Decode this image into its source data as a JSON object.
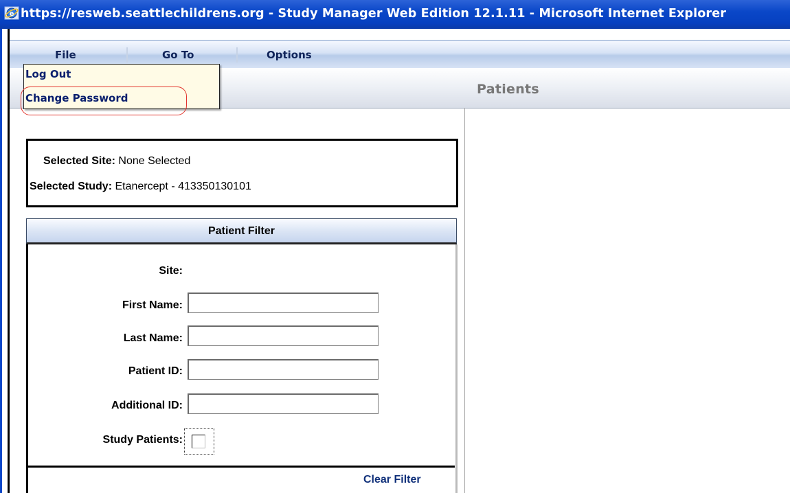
{
  "window": {
    "title": "https://resweb.seattlechildrens.org - Study Manager Web Edition 12.1.11 - Microsoft Internet Explorer"
  },
  "menubar": {
    "items": [
      {
        "label": "File"
      },
      {
        "label": "Go To"
      },
      {
        "label": "Options"
      }
    ]
  },
  "file_menu": {
    "items": [
      {
        "label": "Log Out"
      },
      {
        "label": "Change Password"
      }
    ],
    "highlight_color": "#e2362e"
  },
  "header": {
    "title": "Patients"
  },
  "selection": {
    "site_label": "Selected Site:",
    "site_value": "None Selected",
    "study_label": "Selected Study:",
    "study_value": "Etanercept - 413350130101"
  },
  "filter": {
    "title": "Patient Filter",
    "site_label": "Site:",
    "first_name_label": "First Name:",
    "first_name_value": "",
    "last_name_label": "Last Name:",
    "last_name_value": "",
    "patient_id_label": "Patient ID:",
    "patient_id_value": "",
    "additional_id_label": "Additional ID:",
    "additional_id_value": "",
    "study_patients_label": "Study Patients:",
    "study_patients_checked": false,
    "clear_label": "Clear Filter"
  },
  "colors": {
    "titlebar_blue": "#0a47c8",
    "link_blue": "#10307a"
  }
}
